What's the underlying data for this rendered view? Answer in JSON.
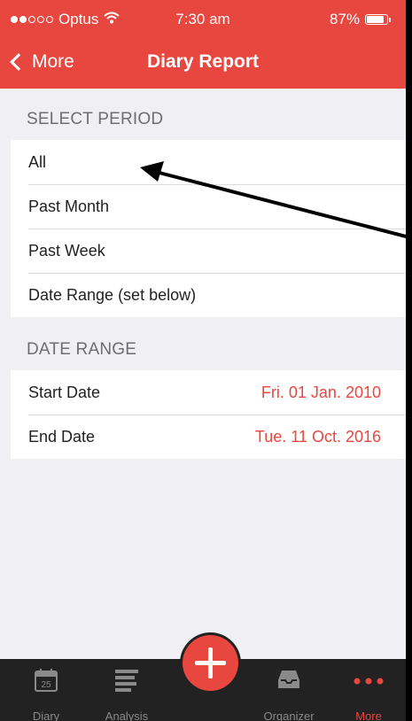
{
  "status": {
    "carrier": "Optus",
    "time": "7:30 am",
    "battery": "87%",
    "battery_level": 0.87
  },
  "nav": {
    "back_label": "More",
    "title": "Diary Report"
  },
  "select_period": {
    "header": "SELECT PERIOD",
    "items": [
      "All",
      "Past Month",
      "Past Week",
      "Date Range (set below)"
    ]
  },
  "date_range": {
    "header": "DATE RANGE",
    "start_label": "Start Date",
    "start_value": "Fri. 01 Jan. 2010",
    "end_label": "End Date",
    "end_value": "Tue. 11 Oct. 2016"
  },
  "tabs": [
    {
      "label": "Diary",
      "icon": "calendar-icon",
      "badge": "25"
    },
    {
      "label": "Analysis",
      "icon": "analysis-icon"
    },
    {
      "label": "Organizer",
      "icon": "tray-icon"
    },
    {
      "label": "More",
      "icon": "more-dots-icon"
    }
  ],
  "colors": {
    "accent": "#e8473f",
    "tabbar": "#222222",
    "background": "#efeff4"
  }
}
